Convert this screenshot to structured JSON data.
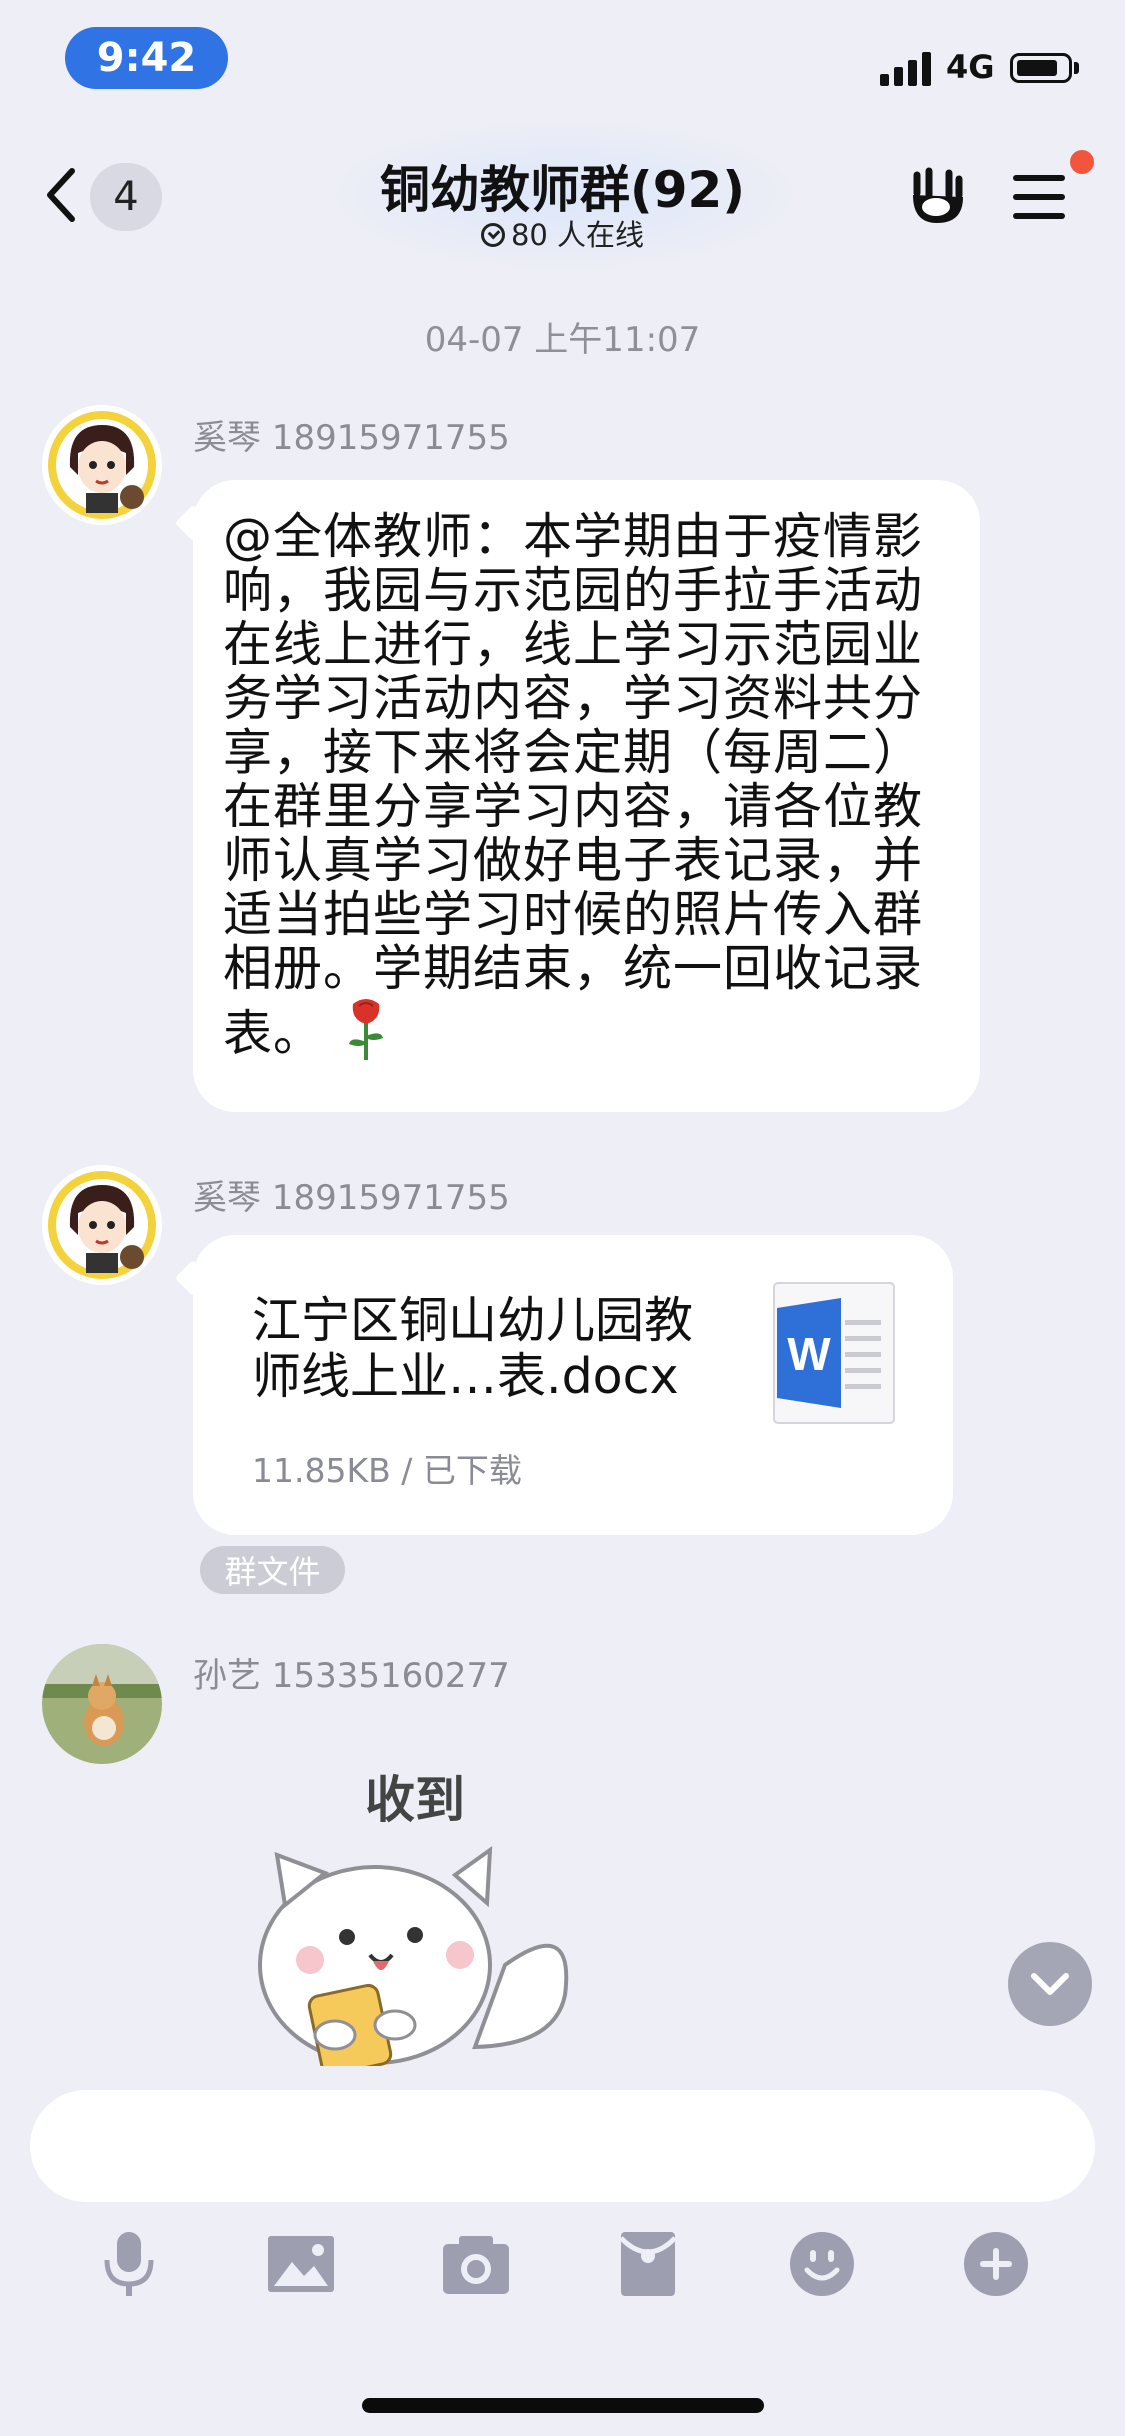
{
  "status_bar": {
    "time": "9:42",
    "network": "4G"
  },
  "header": {
    "unread_count": "4",
    "title": "铜幼教师群(92)",
    "online_text": "80 人在线"
  },
  "chat": {
    "timestamp": "04-07 上午11:07",
    "messages": [
      {
        "sender": "奚琴 18915971755",
        "text": "@全体教师：本学期由于疫情影响，我园与示范园的手拉手活动在线上进行，线上学习示范园业务学习活动内容，学习资料共分享，接下来将会定期（每周二）在群里分享学习内容，请各位教师认真学习做好电子表记录，并适当拍些学习时候的照片传入群相册。学期结束，统一回收记录表。"
      },
      {
        "sender": "奚琴 18915971755",
        "file_name": "江宁区铜山幼儿园教师线上业…表.docx",
        "file_meta": "11.85KB / 已下载",
        "file_tag": "群文件"
      },
      {
        "sender": "孙艺  15335160277",
        "sticker_text": "收到"
      }
    ]
  },
  "icons": {
    "toolbar": [
      "microphone-icon",
      "image-icon",
      "camera-icon",
      "red-packet-icon",
      "emoji-icon",
      "plus-icon"
    ]
  },
  "colors": {
    "time_pill": "#2F73E4",
    "background": "#EDEEF6",
    "badge_dot": "#F2553B"
  }
}
